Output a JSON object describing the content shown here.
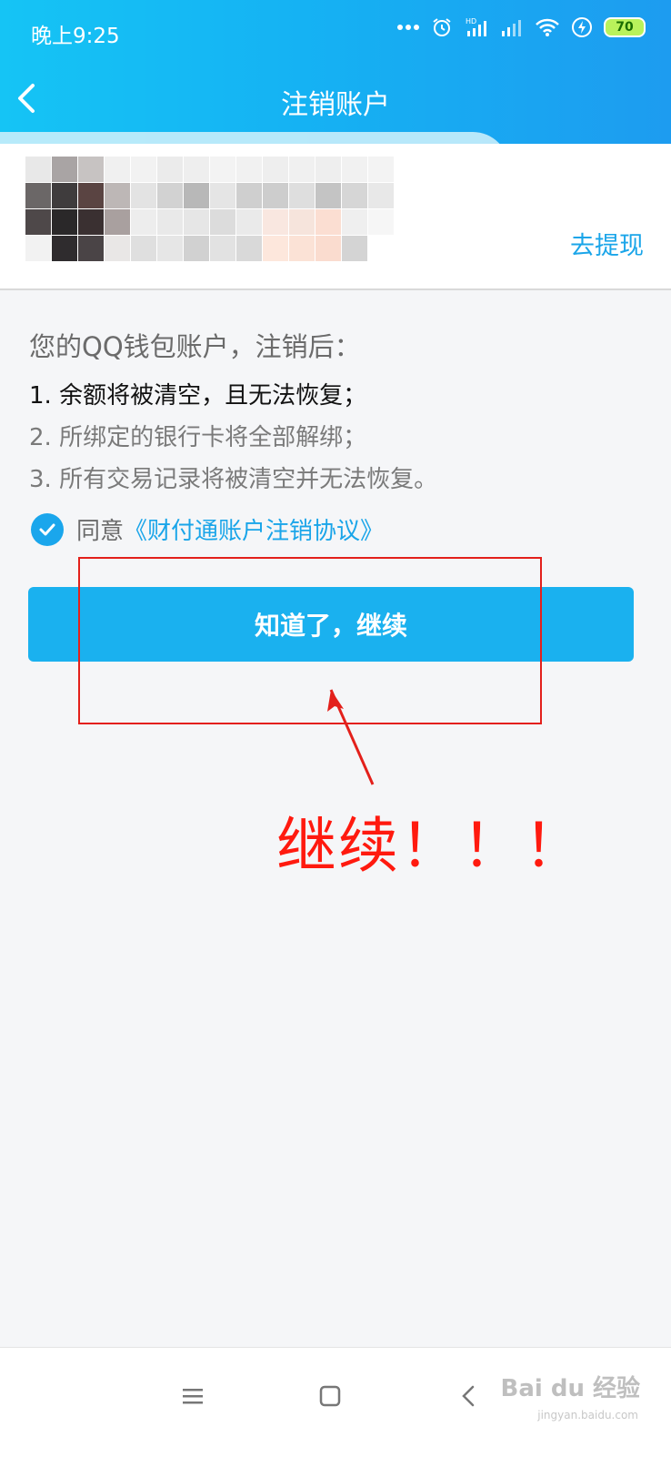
{
  "status_bar": {
    "time": "晚上9:25",
    "battery": "70",
    "icons": [
      "more-dots-icon",
      "alarm-icon",
      "hd-signal-icon",
      "signal-icon",
      "wifi-icon",
      "charging-icon",
      "battery-icon"
    ]
  },
  "header": {
    "title": "注销账户",
    "back_icon": "chevron-left-icon",
    "gradient_start": "#15c4f5",
    "gradient_end": "#1d9cf0"
  },
  "account": {
    "withdraw_label": "去提现"
  },
  "notice": {
    "title": "您的QQ钱包账户，注销后：",
    "items": [
      "1. 余额将被清空，且无法恢复；",
      "2. 所绑定的银行卡将全部解绑；",
      "3. 所有交易记录将被清空并无法恢复。"
    ]
  },
  "agreement": {
    "checked": true,
    "prefix": "同意",
    "link": "《财付通账户注销协议》"
  },
  "primary_button": {
    "label": "知道了，继续",
    "color": "#1ab1ef"
  },
  "annotation": {
    "text": "继续！！！",
    "color": "#ff1a0f"
  },
  "nav_bar": {
    "buttons": [
      "menu-icon",
      "home-square-icon",
      "back-triangle-icon"
    ]
  },
  "watermark": {
    "brand": "Bai du 经验",
    "url": "jingyan.baidu.com"
  }
}
